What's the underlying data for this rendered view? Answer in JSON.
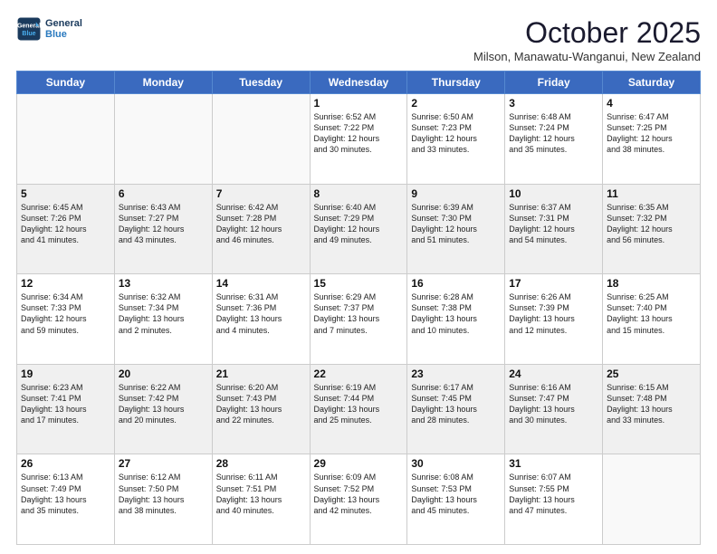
{
  "header": {
    "logo_line1": "General",
    "logo_line2": "Blue",
    "month": "October 2025",
    "location": "Milson, Manawatu-Wanganui, New Zealand"
  },
  "days_of_week": [
    "Sunday",
    "Monday",
    "Tuesday",
    "Wednesday",
    "Thursday",
    "Friday",
    "Saturday"
  ],
  "weeks": [
    [
      {
        "day": "",
        "empty": true
      },
      {
        "day": "",
        "empty": true
      },
      {
        "day": "",
        "empty": true
      },
      {
        "day": "1",
        "lines": [
          "Sunrise: 6:52 AM",
          "Sunset: 7:22 PM",
          "Daylight: 12 hours",
          "and 30 minutes."
        ]
      },
      {
        "day": "2",
        "lines": [
          "Sunrise: 6:50 AM",
          "Sunset: 7:23 PM",
          "Daylight: 12 hours",
          "and 33 minutes."
        ]
      },
      {
        "day": "3",
        "lines": [
          "Sunrise: 6:48 AM",
          "Sunset: 7:24 PM",
          "Daylight: 12 hours",
          "and 35 minutes."
        ]
      },
      {
        "day": "4",
        "lines": [
          "Sunrise: 6:47 AM",
          "Sunset: 7:25 PM",
          "Daylight: 12 hours",
          "and 38 minutes."
        ]
      }
    ],
    [
      {
        "day": "5",
        "lines": [
          "Sunrise: 6:45 AM",
          "Sunset: 7:26 PM",
          "Daylight: 12 hours",
          "and 41 minutes."
        ]
      },
      {
        "day": "6",
        "lines": [
          "Sunrise: 6:43 AM",
          "Sunset: 7:27 PM",
          "Daylight: 12 hours",
          "and 43 minutes."
        ]
      },
      {
        "day": "7",
        "lines": [
          "Sunrise: 6:42 AM",
          "Sunset: 7:28 PM",
          "Daylight: 12 hours",
          "and 46 minutes."
        ]
      },
      {
        "day": "8",
        "lines": [
          "Sunrise: 6:40 AM",
          "Sunset: 7:29 PM",
          "Daylight: 12 hours",
          "and 49 minutes."
        ]
      },
      {
        "day": "9",
        "lines": [
          "Sunrise: 6:39 AM",
          "Sunset: 7:30 PM",
          "Daylight: 12 hours",
          "and 51 minutes."
        ]
      },
      {
        "day": "10",
        "lines": [
          "Sunrise: 6:37 AM",
          "Sunset: 7:31 PM",
          "Daylight: 12 hours",
          "and 54 minutes."
        ]
      },
      {
        "day": "11",
        "lines": [
          "Sunrise: 6:35 AM",
          "Sunset: 7:32 PM",
          "Daylight: 12 hours",
          "and 56 minutes."
        ]
      }
    ],
    [
      {
        "day": "12",
        "lines": [
          "Sunrise: 6:34 AM",
          "Sunset: 7:33 PM",
          "Daylight: 12 hours",
          "and 59 minutes."
        ]
      },
      {
        "day": "13",
        "lines": [
          "Sunrise: 6:32 AM",
          "Sunset: 7:34 PM",
          "Daylight: 13 hours",
          "and 2 minutes."
        ]
      },
      {
        "day": "14",
        "lines": [
          "Sunrise: 6:31 AM",
          "Sunset: 7:36 PM",
          "Daylight: 13 hours",
          "and 4 minutes."
        ]
      },
      {
        "day": "15",
        "lines": [
          "Sunrise: 6:29 AM",
          "Sunset: 7:37 PM",
          "Daylight: 13 hours",
          "and 7 minutes."
        ]
      },
      {
        "day": "16",
        "lines": [
          "Sunrise: 6:28 AM",
          "Sunset: 7:38 PM",
          "Daylight: 13 hours",
          "and 10 minutes."
        ]
      },
      {
        "day": "17",
        "lines": [
          "Sunrise: 6:26 AM",
          "Sunset: 7:39 PM",
          "Daylight: 13 hours",
          "and 12 minutes."
        ]
      },
      {
        "day": "18",
        "lines": [
          "Sunrise: 6:25 AM",
          "Sunset: 7:40 PM",
          "Daylight: 13 hours",
          "and 15 minutes."
        ]
      }
    ],
    [
      {
        "day": "19",
        "lines": [
          "Sunrise: 6:23 AM",
          "Sunset: 7:41 PM",
          "Daylight: 13 hours",
          "and 17 minutes."
        ]
      },
      {
        "day": "20",
        "lines": [
          "Sunrise: 6:22 AM",
          "Sunset: 7:42 PM",
          "Daylight: 13 hours",
          "and 20 minutes."
        ]
      },
      {
        "day": "21",
        "lines": [
          "Sunrise: 6:20 AM",
          "Sunset: 7:43 PM",
          "Daylight: 13 hours",
          "and 22 minutes."
        ]
      },
      {
        "day": "22",
        "lines": [
          "Sunrise: 6:19 AM",
          "Sunset: 7:44 PM",
          "Daylight: 13 hours",
          "and 25 minutes."
        ]
      },
      {
        "day": "23",
        "lines": [
          "Sunrise: 6:17 AM",
          "Sunset: 7:45 PM",
          "Daylight: 13 hours",
          "and 28 minutes."
        ]
      },
      {
        "day": "24",
        "lines": [
          "Sunrise: 6:16 AM",
          "Sunset: 7:47 PM",
          "Daylight: 13 hours",
          "and 30 minutes."
        ]
      },
      {
        "day": "25",
        "lines": [
          "Sunrise: 6:15 AM",
          "Sunset: 7:48 PM",
          "Daylight: 13 hours",
          "and 33 minutes."
        ]
      }
    ],
    [
      {
        "day": "26",
        "lines": [
          "Sunrise: 6:13 AM",
          "Sunset: 7:49 PM",
          "Daylight: 13 hours",
          "and 35 minutes."
        ]
      },
      {
        "day": "27",
        "lines": [
          "Sunrise: 6:12 AM",
          "Sunset: 7:50 PM",
          "Daylight: 13 hours",
          "and 38 minutes."
        ]
      },
      {
        "day": "28",
        "lines": [
          "Sunrise: 6:11 AM",
          "Sunset: 7:51 PM",
          "Daylight: 13 hours",
          "and 40 minutes."
        ]
      },
      {
        "day": "29",
        "lines": [
          "Sunrise: 6:09 AM",
          "Sunset: 7:52 PM",
          "Daylight: 13 hours",
          "and 42 minutes."
        ]
      },
      {
        "day": "30",
        "lines": [
          "Sunrise: 6:08 AM",
          "Sunset: 7:53 PM",
          "Daylight: 13 hours",
          "and 45 minutes."
        ]
      },
      {
        "day": "31",
        "lines": [
          "Sunrise: 6:07 AM",
          "Sunset: 7:55 PM",
          "Daylight: 13 hours",
          "and 47 minutes."
        ]
      },
      {
        "day": "",
        "empty": true
      }
    ]
  ]
}
